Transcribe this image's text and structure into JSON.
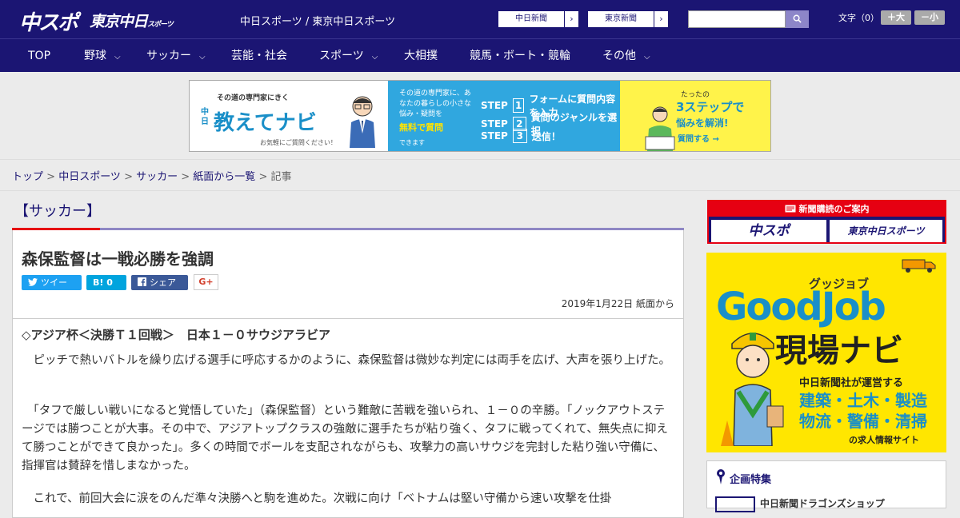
{
  "header": {
    "logo_main": "中スポ",
    "logo_tokyo": "東京中日",
    "logo_tokyo_small": "スポーツ",
    "site_title": "中日スポーツ / 東京中日スポーツ",
    "ext_links": [
      {
        "label": "中日新聞",
        "arrow": "›"
      },
      {
        "label": "東京新聞",
        "arrow": "›"
      }
    ],
    "search_placeholder": "",
    "font_label": "文字（0）",
    "font_bigger": "＋大",
    "font_smaller": "－小"
  },
  "nav": {
    "items": [
      {
        "label": "TOP",
        "dropdown": ""
      },
      {
        "label": "野球",
        "dropdown": "⌵"
      },
      {
        "label": "サッカー",
        "dropdown": "⌵"
      },
      {
        "label": "芸能・社会",
        "dropdown": ""
      },
      {
        "label": "スポーツ",
        "dropdown": "⌵"
      },
      {
        "label": "大相撲",
        "dropdown": ""
      },
      {
        "label": "競馬・ボート・競輪",
        "dropdown": ""
      },
      {
        "label": "その他",
        "dropdown": "⌵"
      }
    ]
  },
  "banner": {
    "tagline": "その道の専門家にきく",
    "chunichi": "中日",
    "name": "教えてナビ",
    "subtitle": "お気軽にご質問ください！",
    "desc": "その道の専門家に、あなたの暮らしの小さな悩み・疑問を",
    "free": "無料で質問",
    "can": "できます",
    "steps": [
      {
        "label": "STEP",
        "num": "1",
        "text": "フォームに質問内容を入力"
      },
      {
        "label": "STEP",
        "num": "2",
        "text": "質問のジャンルを選択"
      },
      {
        "label": "STEP",
        "num": "3",
        "text": "送信！"
      }
    ],
    "easy": "たったの",
    "three": "3ステップで",
    "solve": "悩みを解消!",
    "ask": "質問する →"
  },
  "breadcrumb": {
    "links": [
      "トップ",
      "中日スポーツ",
      "サッカー",
      "紙面から一覧"
    ],
    "current": "記事",
    "sep": " > "
  },
  "article": {
    "category": "【サッカー】",
    "headline": "森保監督は一戦必勝を強調",
    "share": {
      "tweet": "ツイート",
      "hatena": "B! 0",
      "facebook": "シェア 0",
      "gplus": "G+"
    },
    "date": "2019年1月22日 紙面から",
    "subhead": "◇アジア杯＜決勝Ｔ１回戦＞　日本１－０サウジアラビア",
    "paragraphs": [
      "　ピッチで熱いバトルを繰り広げる選手に呼応するかのように、森保監督は微妙な判定には両手を広げ、大声を張り上げた。",
      "　「タフで厳しい戦いになると覚悟していた」（森保監督）という難敵に苦戦を強いられ、１－０の辛勝。「ノックアウトステージでは勝つことが大事。その中で、アジアトップクラスの強敵に選手たちが粘り強く、タフに戦ってくれて、無失点に抑えて勝つことができて良かった」。多くの時間でボールを支配されながらも、攻撃力の高いサウジを完封した粘り強い守備に、指揮官は賛辞を惜しまなかった。",
      "　これで、前回大会に涙をのんだ準々決勝へと駒を進めた。次戦に向け「ベトナムは堅い守備から速い攻撃を仕掛"
    ]
  },
  "sidebar": {
    "subscribe_header": "新聞購読のご案内",
    "subscribe_chuspo": "中スポ",
    "subscribe_tokyo": "東京中日スポーツ",
    "job": {
      "kana": "グッジョブ",
      "title": "GoodJob",
      "genba": "現場ナビ",
      "desc": "中日新聞社が運営する",
      "cats_line1": "建築・土木・製造",
      "cats_line2": "物流・警備・清掃",
      "site": "の求人情報サイト"
    },
    "feature_title": "企画特集",
    "feature_item": "中日新聞ドラゴンズショップ"
  },
  "colors": {
    "brand_navy": "#1b1573",
    "accent_red": "#e60012",
    "twitter": "#1da1f2",
    "hatena": "#00a4de",
    "facebook": "#3b5998"
  }
}
